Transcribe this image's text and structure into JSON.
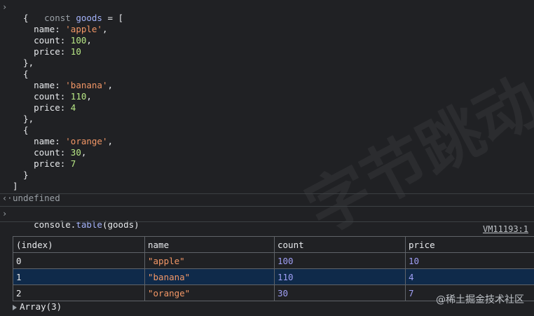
{
  "entry1": {
    "lines": [
      [
        "const",
        " ",
        "goods",
        " = ["
      ],
      [
        "  {"
      ],
      [
        "    name: ",
        "'apple'",
        ","
      ],
      [
        "    count: ",
        "100",
        ","
      ],
      [
        "    price: ",
        "10"
      ],
      [
        "  },"
      ],
      [
        "  {"
      ],
      [
        "    name: ",
        "'banana'",
        ","
      ],
      [
        "    count: ",
        "110",
        ","
      ],
      [
        "    price: ",
        "4"
      ],
      [
        "  },"
      ],
      [
        "  {"
      ],
      [
        "    name: ",
        "'orange'",
        ","
      ],
      [
        "    count: ",
        "30",
        ","
      ],
      [
        "    price: ",
        "7"
      ],
      [
        "  }"
      ],
      [
        "]"
      ]
    ],
    "result": "undefined"
  },
  "entry2": {
    "obj": "console",
    "method": "table",
    "arg": "(goods)",
    "source": "VM11193:1",
    "table": {
      "headers": [
        "(index)",
        "name",
        "count",
        "price"
      ],
      "rows": [
        [
          "0",
          "\"apple\"",
          "100",
          "10"
        ],
        [
          "1",
          "\"banana\"",
          "110",
          "4"
        ],
        [
          "2",
          "\"orange\"",
          "30",
          "7"
        ]
      ]
    },
    "array_label": "Array(3)"
  },
  "watermark": "字节跳动",
  "footer": "@稀土掘金技术社区"
}
